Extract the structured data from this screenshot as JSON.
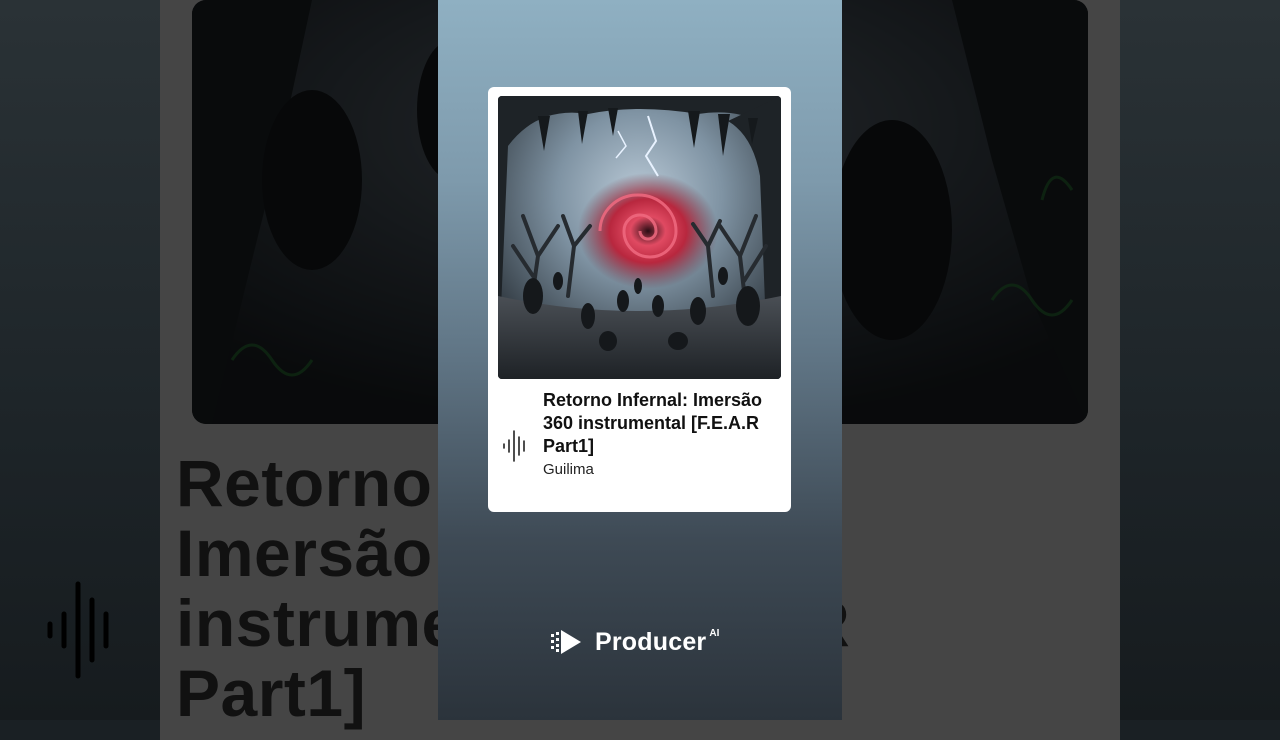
{
  "track": {
    "title": "Retorno Infernal: Imersão 360 instrumental [F.E.A.R Part1]",
    "artist": "Guilima"
  },
  "brand": {
    "name": "Producer",
    "superscript": "AI"
  },
  "colors": {
    "vortex": "#d33048",
    "column_top": "#8fb0c2",
    "column_bottom": "#2b333b",
    "card": "#ffffff"
  },
  "icons": {
    "waveform": "audio-waveform-icon",
    "logo": "producer-logo-icon"
  }
}
